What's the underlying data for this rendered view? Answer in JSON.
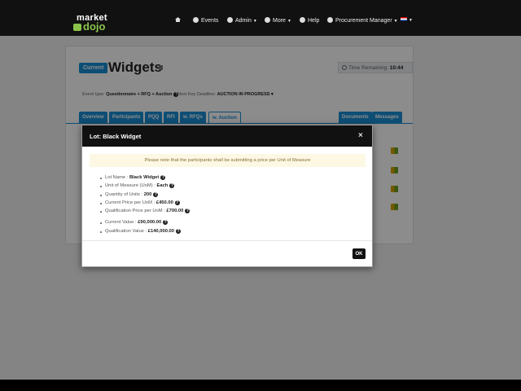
{
  "brand": {
    "line1": "market",
    "line2": "dojo"
  },
  "nav": {
    "events": "Events",
    "admin": "Admin",
    "more": "More",
    "help": "Help",
    "user": "Procurement Manager"
  },
  "event": {
    "status_badge": "Current",
    "title": "Widgets",
    "time_label": "Time Remaining:",
    "time_value": "10:44",
    "type_label": "Event type:",
    "type_value": "Questionnaire + RFQ + Auction",
    "deadline_label": "Next Key Deadline:",
    "deadline_value": "AUCTION IN PROGRESS"
  },
  "tabs": {
    "overview": "Overview",
    "participants": "Participants",
    "pqq": "PQQ",
    "rfi": "RFI",
    "rfqs": "w. RFQs",
    "auction": "w. Auction",
    "documents": "Documents",
    "messages": "Messages"
  },
  "modal": {
    "title": "Lot: Black Widget",
    "close": "×",
    "notice": "Please note that the participants shall be submitting a price per Unit of Measure",
    "items": [
      {
        "label": "Lot Name :",
        "value": "Black Widget"
      },
      {
        "label": "Unit of Measure (UoM) :",
        "value": "Each"
      },
      {
        "label": "Quantity of Units :",
        "value": "200"
      },
      {
        "label": "Current Price per UoM :",
        "value": "£450.00"
      },
      {
        "label": "Qualification Price per UoM :",
        "value": "£700.00"
      },
      {
        "label": "Current Value :",
        "value": "£90,000.00"
      },
      {
        "label": "Qualification Value :",
        "value": "£140,000.00"
      }
    ],
    "ok": "OK"
  }
}
